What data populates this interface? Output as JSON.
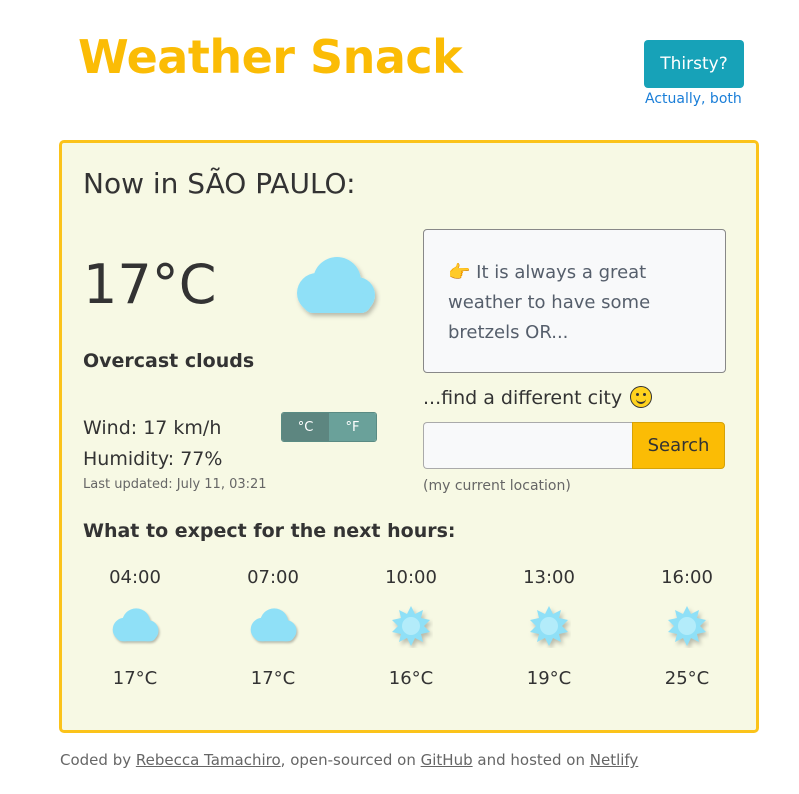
{
  "header": {
    "title": "Weather Snack",
    "thirsty_label": "Thirsty?",
    "actually_label": "Actually, both"
  },
  "current": {
    "heading": "Now in SÃO PAULO:",
    "temperature": "17°C",
    "icon": "cloud-icon",
    "description": "Overcast clouds",
    "wind": "Wind: 17 km/h",
    "humidity": "Humidity: 77%",
    "updated": "Last updated: July 11, 03:21",
    "unit_c": "°C",
    "unit_f": "°F"
  },
  "snack": {
    "emoji": "👉",
    "text": "It is always a great weather to have some bretzels OR..."
  },
  "search": {
    "prompt": "...find a different city",
    "placeholder": "",
    "button_label": "Search",
    "current_location": "(my current location)"
  },
  "forecast": {
    "heading": "What to expect for the next hours:",
    "hours": [
      {
        "time": "04:00",
        "icon": "cloud-icon",
        "temp": "17°C"
      },
      {
        "time": "07:00",
        "icon": "cloud-icon",
        "temp": "17°C"
      },
      {
        "time": "10:00",
        "icon": "sun-icon",
        "temp": "16°C"
      },
      {
        "time": "13:00",
        "icon": "sun-icon",
        "temp": "19°C"
      },
      {
        "time": "16:00",
        "icon": "sun-icon",
        "temp": "25°C"
      }
    ]
  },
  "footer": {
    "prefix": "Coded by",
    "author": "Rebecca Tamachiro",
    "middle": ", open-sourced on",
    "github": "GitHub",
    "and": "and hosted on",
    "netlify": "Netlify"
  },
  "colors": {
    "brand_yellow": "#fbbc05",
    "card_bg": "#f7f9e4",
    "thirsty_button": "#17a2b8",
    "cloud": "#8fe0f7"
  }
}
